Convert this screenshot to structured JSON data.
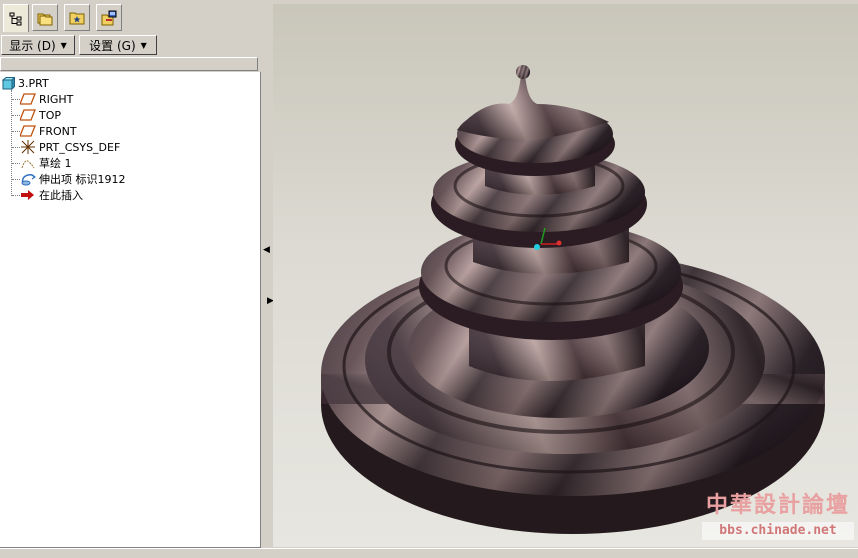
{
  "tabs": [
    {
      "name": "model-tree-tab"
    },
    {
      "name": "folder-browser-tab"
    },
    {
      "name": "favorites-tab"
    },
    {
      "name": "connections-tab"
    }
  ],
  "menus": {
    "display_label": "显示 (D)",
    "settings_label": "设置 (G)"
  },
  "tree": {
    "root": "3.PRT",
    "items": [
      {
        "label": "RIGHT",
        "icon": "datum-plane-icon"
      },
      {
        "label": "TOP",
        "icon": "datum-plane-icon"
      },
      {
        "label": "FRONT",
        "icon": "datum-plane-icon"
      },
      {
        "label": "PRT_CSYS_DEF",
        "icon": "coordinate-system-icon"
      },
      {
        "label": "草绘 1",
        "icon": "sketch-icon"
      },
      {
        "label": "伸出项 标识1912",
        "icon": "revolve-protrusion-icon"
      },
      {
        "label": "在此插入",
        "icon": "insert-here-arrow-icon"
      }
    ]
  },
  "watermark": {
    "logo": "中華設計論壇",
    "url": "bbs.chinade.net"
  },
  "colors": {
    "panel": "#d4d0c8",
    "model_dark": "#3a2a30",
    "model_light": "#b89a98",
    "watermark": "#e8a0a0"
  }
}
